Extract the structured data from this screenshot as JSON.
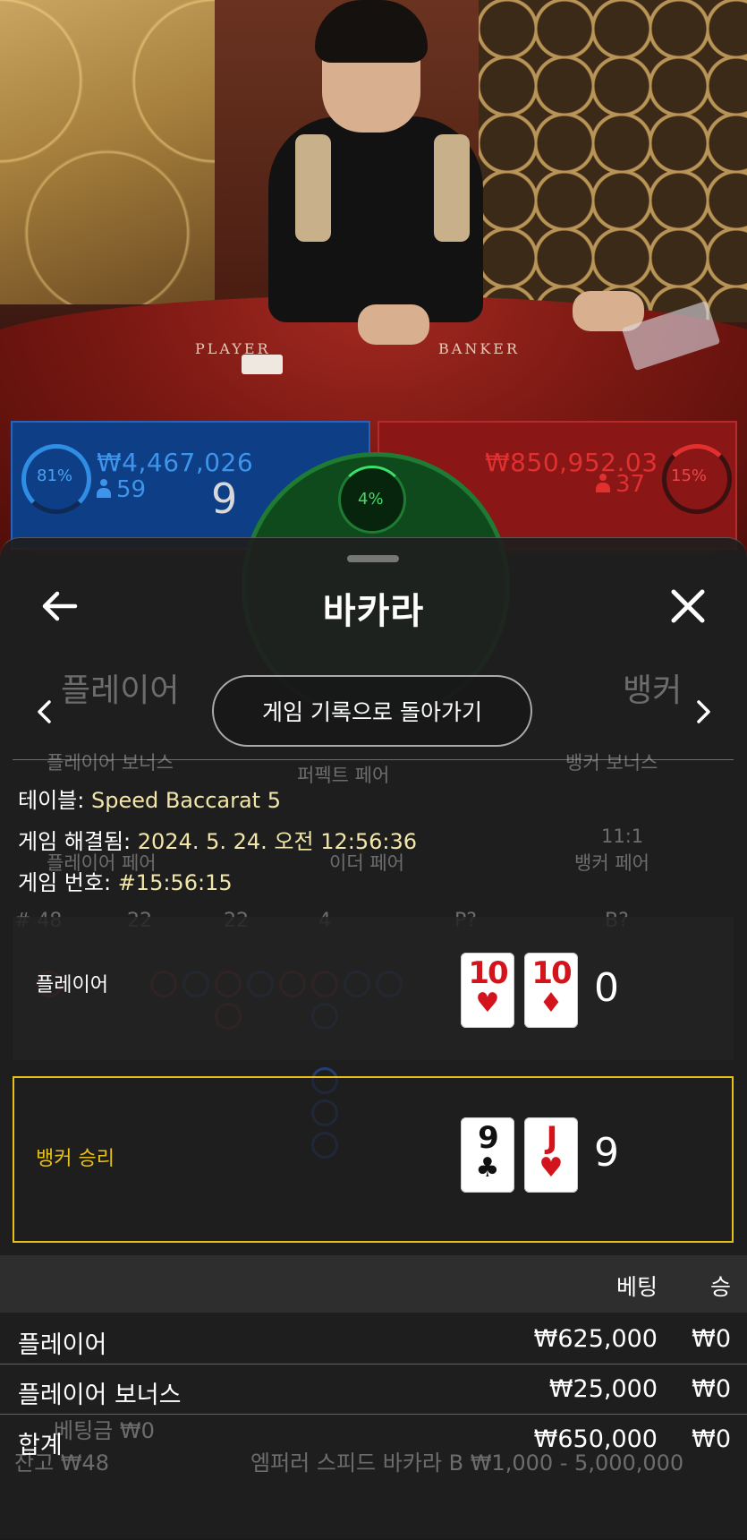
{
  "video": {
    "felt_labels": [
      "PLAYER",
      "BANKER"
    ]
  },
  "stats": {
    "player": {
      "percent": "81%",
      "amount": "₩4,467,026",
      "players": "59",
      "score": "9",
      "color": "#2f8de4"
    },
    "tie": {
      "percent": "4%",
      "color": "#46d86a"
    },
    "banker": {
      "percent": "15%",
      "amount": "₩850,952.03",
      "players": "37",
      "color": "#e23030"
    }
  },
  "background_labels": {
    "player_bet": "플레이어",
    "banker_bet": "뱅커",
    "player_bonus": "플레이어 보너스",
    "perfect_pair": "퍼펙트 페어",
    "banker_bonus": "뱅커 보너스",
    "player_pair": "플레이어 페어",
    "either_pair": "이더 페어",
    "banker_pair_odds": "11:1",
    "banker_pair": "뱅커 페어",
    "rounds": "# 48",
    "p_wins": "22",
    "b_wins": "22",
    "ties": "4",
    "p_q": "P?",
    "b_q": "B?",
    "balance": "잔고 ₩48",
    "total_bet": "베팅금 ₩0",
    "table_info": "엠퍼러 스피드 바카라 B  ₩1,000 - 5,000,000"
  },
  "sheet": {
    "title": "바카라",
    "back_icon": "arrow-left-icon",
    "close_icon": "close-icon",
    "return_button": "게임 기록으로 돌아가기",
    "table_label": "테이블:",
    "table_value": "Speed Baccarat 5",
    "resolved_label": "게임 해결됨:",
    "resolved_value": "2024. 5. 24. 오전 12:56:36",
    "game_no_label": "게임 번호:",
    "game_no_value": "#15:56:15",
    "accent": "#e7c11a"
  },
  "hands": {
    "player": {
      "label": "플레이어",
      "cards": [
        {
          "rank": "10",
          "suit": "♥"
        },
        {
          "rank": "10",
          "suit": "♦"
        }
      ],
      "score": "0"
    },
    "banker": {
      "label": "뱅커 승리",
      "cards": [
        {
          "rank": "9",
          "suit": "♣"
        },
        {
          "rank": "J",
          "suit": "♥"
        }
      ],
      "score": "9"
    }
  },
  "bets": {
    "headers": {
      "bet": "베팅",
      "win": "승"
    },
    "rows": [
      {
        "name": "플레이어",
        "bet": "₩625,000",
        "win": "₩0"
      },
      {
        "name": "플레이어 보너스",
        "bet": "₩25,000",
        "win": "₩0"
      },
      {
        "name": "합계",
        "bet": "₩650,000",
        "win": "₩0"
      }
    ]
  }
}
